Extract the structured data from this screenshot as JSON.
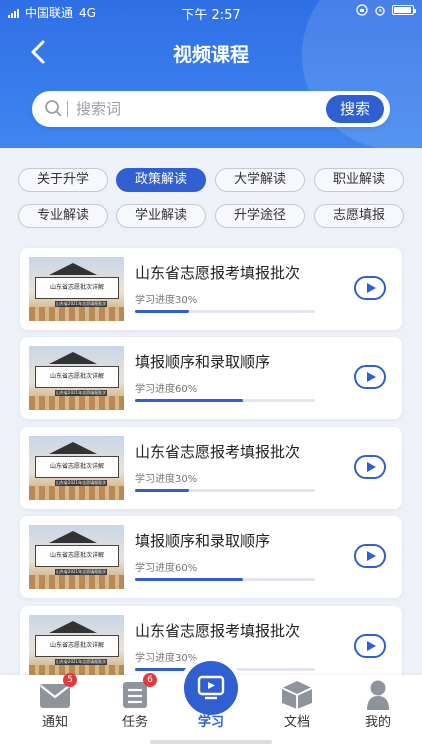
{
  "status": {
    "carrier": "中国联通",
    "network": "4G",
    "time": "下午 2:57"
  },
  "navbar": {
    "title": "视频课程"
  },
  "search": {
    "placeholder": "搜索词",
    "button": "搜索"
  },
  "tags": [
    {
      "label": "关于升学",
      "active": false
    },
    {
      "label": "政策解读",
      "active": true
    },
    {
      "label": "大学解读",
      "active": false
    },
    {
      "label": "职业解读",
      "active": false
    },
    {
      "label": "专业解读",
      "active": false
    },
    {
      "label": "学业解读",
      "active": false
    },
    {
      "label": "升学途径",
      "active": false
    },
    {
      "label": "志愿填报",
      "active": false
    }
  ],
  "thumb": {
    "board_text": "山东省志愿批次详解",
    "strip_text": "山东省2021年志愿填报批次详解"
  },
  "courses": [
    {
      "title": "山东省志愿报考填报批次",
      "progress_label": "学习进度30%",
      "progress": 0.3
    },
    {
      "title": "填报顺序和录取顺序",
      "progress_label": "学习进度60%",
      "progress": 0.6
    },
    {
      "title": "山东省志愿报考填报批次",
      "progress_label": "学习进度30%",
      "progress": 0.3
    },
    {
      "title": "填报顺序和录取顺序",
      "progress_label": "学习进度60%",
      "progress": 0.6
    },
    {
      "title": "山东省志愿报考填报批次",
      "progress_label": "学习进度30%",
      "progress": 0.3
    }
  ],
  "tabbar": [
    {
      "label": "通知",
      "icon": "mail-icon",
      "badge": "5",
      "active": false
    },
    {
      "label": "任务",
      "icon": "list-icon",
      "badge": "6",
      "active": false
    },
    {
      "label": "学习",
      "icon": "tv-play-icon",
      "badge": "",
      "active": true
    },
    {
      "label": "文档",
      "icon": "box-icon",
      "badge": "",
      "active": false
    },
    {
      "label": "我的",
      "icon": "person-icon",
      "badge": "",
      "active": false
    }
  ],
  "colors": {
    "primary": "#2f5fd1",
    "header": "#3f86f0",
    "badge": "#e23b3b"
  }
}
